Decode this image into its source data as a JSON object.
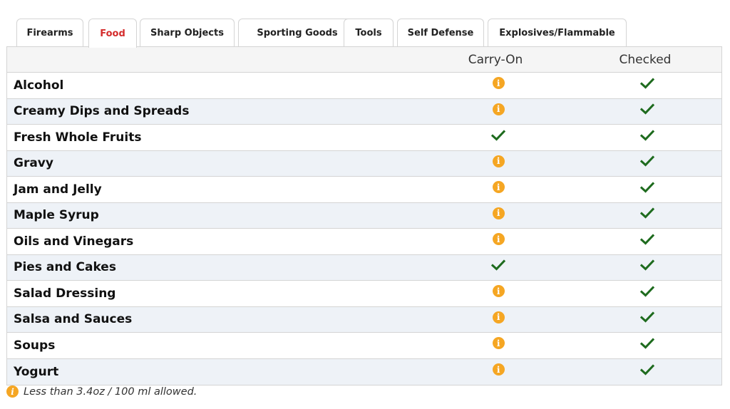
{
  "tabs": [
    {
      "label": "Firearms",
      "active": false
    },
    {
      "label": "Food",
      "active": true
    },
    {
      "label": "Sharp Objects",
      "active": false
    },
    {
      "label": "Sporting Goods",
      "active": false
    },
    {
      "label": "Tools",
      "active": false
    },
    {
      "label": "Self Defense",
      "active": false
    },
    {
      "label": "Explosives/Flammable",
      "active": false
    }
  ],
  "table": {
    "headers": {
      "item": "",
      "carry_on": "Carry-On",
      "checked": "Checked"
    },
    "rows": [
      {
        "name": "Alcohol",
        "carry_on": "info",
        "checked": "check"
      },
      {
        "name": "Creamy Dips and Spreads",
        "carry_on": "info",
        "checked": "check"
      },
      {
        "name": "Fresh Whole Fruits",
        "carry_on": "check",
        "checked": "check"
      },
      {
        "name": "Gravy",
        "carry_on": "info",
        "checked": "check"
      },
      {
        "name": "Jam and Jelly",
        "carry_on": "info",
        "checked": "check"
      },
      {
        "name": "Maple Syrup",
        "carry_on": "info",
        "checked": "check"
      },
      {
        "name": "Oils and Vinegars",
        "carry_on": "info",
        "checked": "check"
      },
      {
        "name": "Pies and Cakes",
        "carry_on": "check",
        "checked": "check"
      },
      {
        "name": "Salad Dressing",
        "carry_on": "info",
        "checked": "check"
      },
      {
        "name": "Salsa and Sauces",
        "carry_on": "info",
        "checked": "check"
      },
      {
        "name": "Soups",
        "carry_on": "info",
        "checked": "check"
      },
      {
        "name": "Yogurt",
        "carry_on": "info",
        "checked": "check"
      }
    ]
  },
  "footnote": {
    "icon": "info-icon",
    "text": "Less than 3.4oz / 100 ml allowed."
  },
  "colors": {
    "active_tab": "#d42b2b",
    "info": "#f5a623",
    "check": "#1e6b1e",
    "alt_row": "#eef2f7"
  }
}
